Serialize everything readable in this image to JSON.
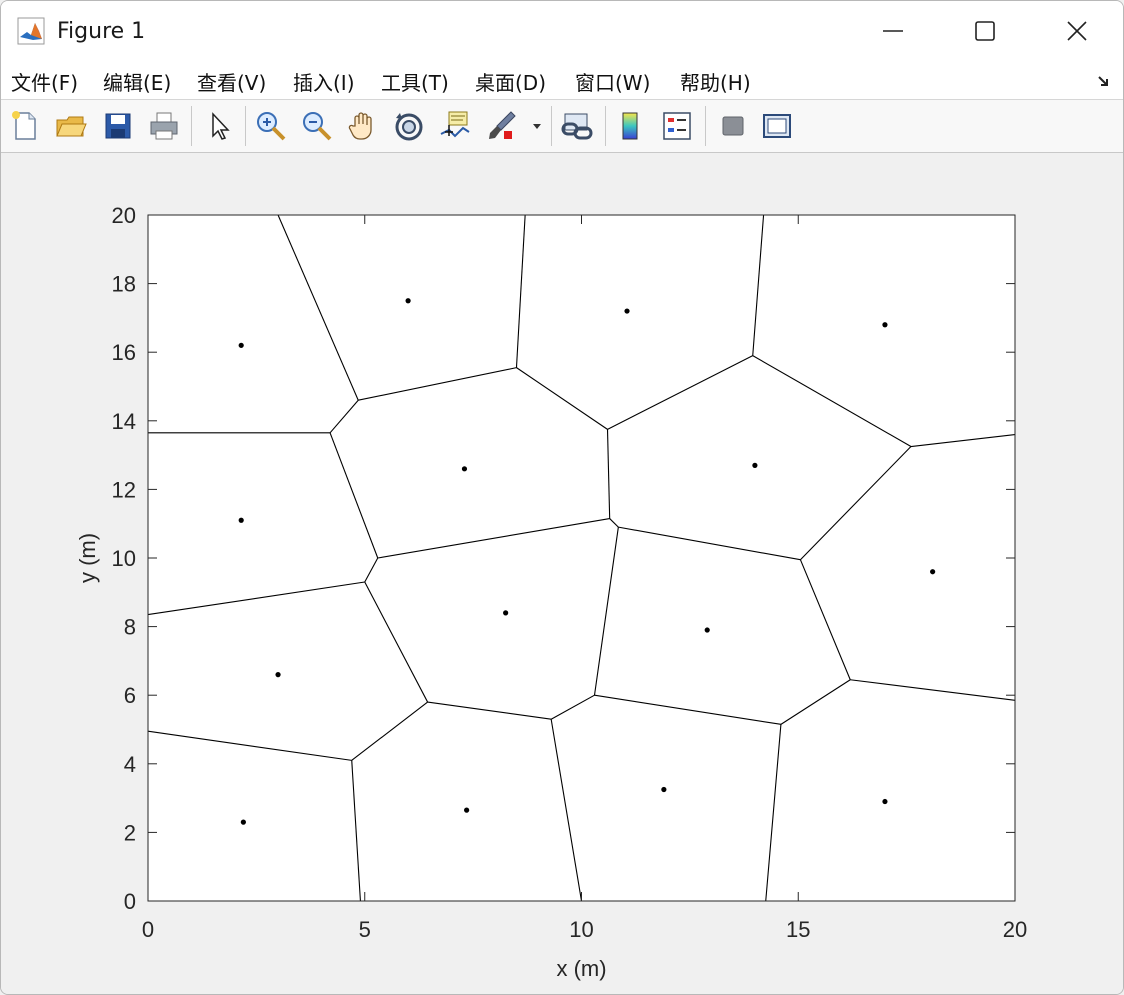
{
  "window": {
    "title": "Figure 1",
    "icon": "matlab-logo-icon",
    "controls": [
      "minimize-icon",
      "maximize-icon",
      "close-icon"
    ]
  },
  "menubar": {
    "items": [
      "文件(F)",
      "编辑(E)",
      "查看(V)",
      "插入(I)",
      "工具(T)",
      "桌面(D)",
      "窗口(W)",
      "帮助(H)"
    ],
    "dock_icon": "dock-arrow-icon"
  },
  "toolbar": {
    "icons": [
      "new-figure-icon",
      "open-file-icon",
      "save-icon",
      "print-icon",
      "select-pointer-icon",
      "zoom-in-icon",
      "zoom-out-icon",
      "pan-hand-icon",
      "rotate-3d-icon",
      "data-cursor-icon",
      "brush-icon",
      "brush-dropdown-icon",
      "link-plot-icon",
      "colorbar-icon",
      "legend-icon",
      "hide-plot-tools-icon",
      "show-plot-tools-icon"
    ]
  },
  "chart_data": {
    "type": "scatter",
    "subtype": "voronoi",
    "xlabel": "x (m)",
    "ylabel": "y (m)",
    "xlim": [
      0,
      20
    ],
    "ylim": [
      0,
      20
    ],
    "xticks": [
      0,
      5,
      10,
      15,
      20
    ],
    "yticks": [
      0,
      2,
      4,
      6,
      8,
      10,
      12,
      14,
      16,
      18,
      20
    ],
    "grid": false,
    "points": [
      {
        "x": 2.15,
        "y": 16.2
      },
      {
        "x": 6.0,
        "y": 17.5
      },
      {
        "x": 11.05,
        "y": 17.2
      },
      {
        "x": 17.0,
        "y": 16.8
      },
      {
        "x": 7.3,
        "y": 12.6
      },
      {
        "x": 14.0,
        "y": 12.7
      },
      {
        "x": 2.15,
        "y": 11.1
      },
      {
        "x": 8.25,
        "y": 8.4
      },
      {
        "x": 12.9,
        "y": 7.9
      },
      {
        "x": 18.1,
        "y": 9.6
      },
      {
        "x": 3.0,
        "y": 6.6
      },
      {
        "x": 2.2,
        "y": 2.3
      },
      {
        "x": 7.35,
        "y": 2.65
      },
      {
        "x": 11.9,
        "y": 3.25
      },
      {
        "x": 17.0,
        "y": 2.9
      }
    ],
    "edges": [
      [
        [
          3.0,
          20
        ],
        [
          4.85,
          14.6
        ]
      ],
      [
        [
          4.85,
          14.6
        ],
        [
          4.2,
          13.65
        ]
      ],
      [
        [
          0,
          13.65
        ],
        [
          4.2,
          13.65
        ]
      ],
      [
        [
          4.85,
          14.6
        ],
        [
          8.5,
          15.55
        ]
      ],
      [
        [
          8.5,
          15.55
        ],
        [
          8.7,
          20
        ]
      ],
      [
        [
          8.5,
          15.55
        ],
        [
          10.6,
          13.75
        ]
      ],
      [
        [
          10.6,
          13.75
        ],
        [
          13.95,
          15.9
        ]
      ],
      [
        [
          13.95,
          15.9
        ],
        [
          14.2,
          20
        ]
      ],
      [
        [
          13.95,
          15.9
        ],
        [
          17.6,
          13.25
        ]
      ],
      [
        [
          17.6,
          13.25
        ],
        [
          20,
          13.6
        ]
      ],
      [
        [
          10.6,
          13.75
        ],
        [
          10.65,
          11.15
        ]
      ],
      [
        [
          4.2,
          13.65
        ],
        [
          5.3,
          10.0
        ]
      ],
      [
        [
          5.3,
          10.0
        ],
        [
          10.65,
          11.15
        ]
      ],
      [
        [
          10.65,
          11.15
        ],
        [
          10.85,
          10.9
        ]
      ],
      [
        [
          10.85,
          10.9
        ],
        [
          15.05,
          9.95
        ]
      ],
      [
        [
          15.05,
          9.95
        ],
        [
          17.6,
          13.25
        ]
      ],
      [
        [
          5.3,
          10.0
        ],
        [
          5.0,
          9.3
        ]
      ],
      [
        [
          0,
          8.35
        ],
        [
          5.0,
          9.3
        ]
      ],
      [
        [
          5.0,
          9.3
        ],
        [
          6.45,
          5.8
        ]
      ],
      [
        [
          6.45,
          5.8
        ],
        [
          9.3,
          5.3
        ]
      ],
      [
        [
          6.45,
          5.8
        ],
        [
          4.7,
          4.1
        ]
      ],
      [
        [
          0,
          4.95
        ],
        [
          4.7,
          4.1
        ]
      ],
      [
        [
          4.7,
          4.1
        ],
        [
          4.9,
          0
        ]
      ],
      [
        [
          9.3,
          5.3
        ],
        [
          10.3,
          6.0
        ]
      ],
      [
        [
          10.3,
          6.0
        ],
        [
          10.85,
          10.9
        ]
      ],
      [
        [
          9.3,
          5.3
        ],
        [
          10.0,
          0
        ]
      ],
      [
        [
          10.3,
          6.0
        ],
        [
          14.6,
          5.15
        ]
      ],
      [
        [
          14.6,
          5.15
        ],
        [
          14.25,
          0
        ]
      ],
      [
        [
          14.6,
          5.15
        ],
        [
          16.2,
          6.45
        ]
      ],
      [
        [
          16.2,
          6.45
        ],
        [
          15.05,
          9.95
        ]
      ],
      [
        [
          16.2,
          6.45
        ],
        [
          20,
          5.85
        ]
      ]
    ]
  }
}
